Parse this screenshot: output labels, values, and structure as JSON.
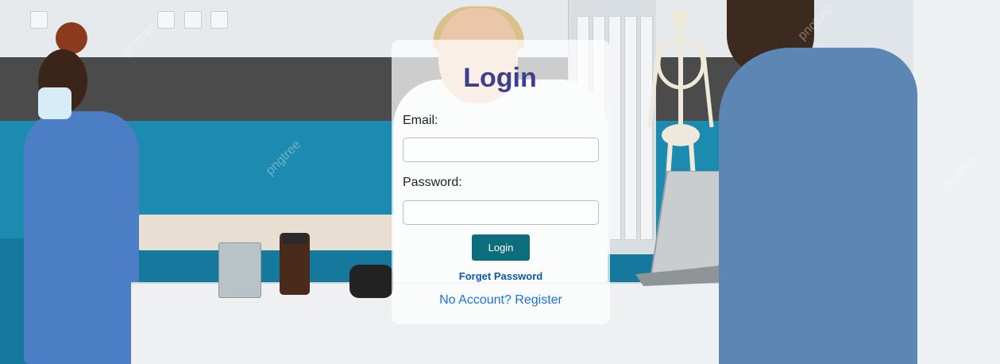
{
  "login": {
    "title": "Login",
    "email_label": "Email:",
    "email_value": "",
    "email_placeholder": "",
    "password_label": "Password:",
    "password_value": "",
    "password_placeholder": "",
    "submit_label": "Login",
    "forget_password_label": "Forget Password",
    "register_label": "No Account? Register"
  },
  "background": {
    "watermark_text": "pngtree"
  },
  "colors": {
    "title": "#3d3f8e",
    "button_bg": "#0e6d7d",
    "forget_link": "#0b57b8",
    "register_link": "#1a73d9"
  }
}
